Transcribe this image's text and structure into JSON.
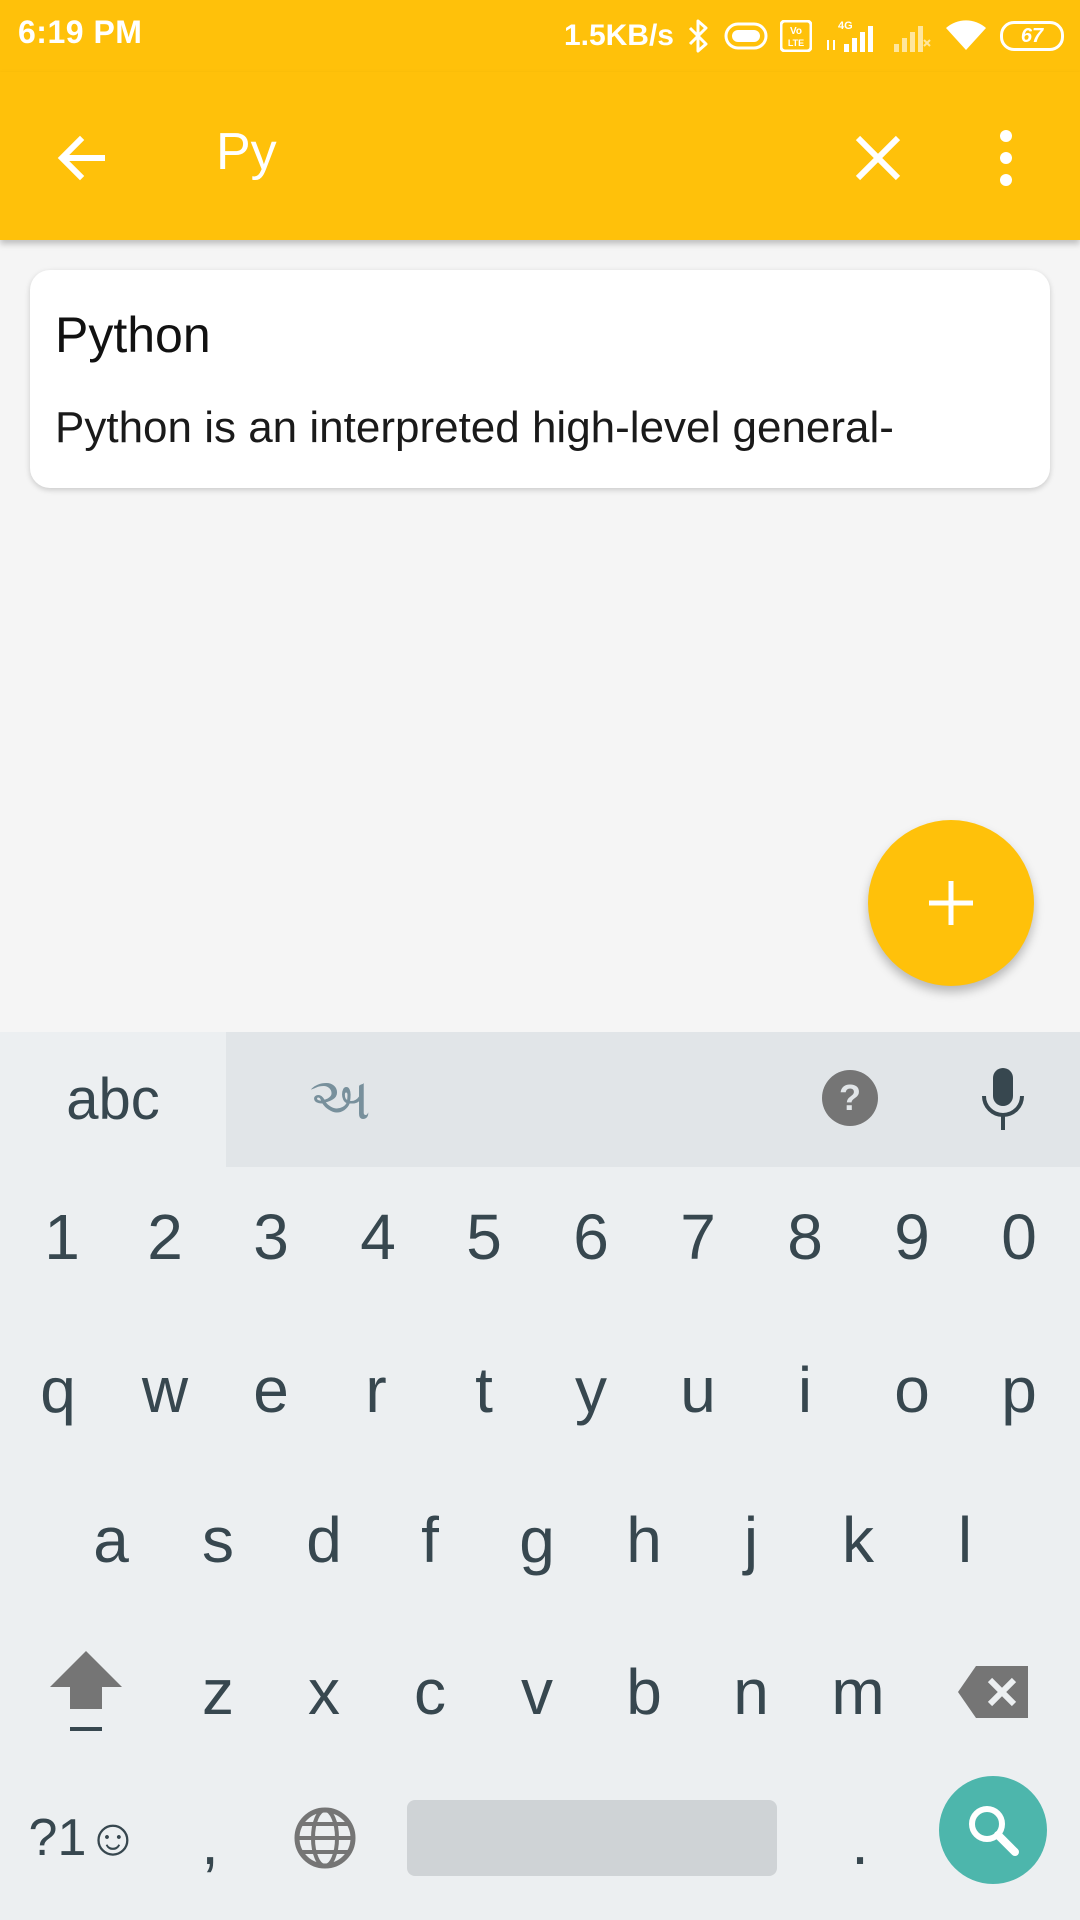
{
  "status_bar": {
    "time": "6:19 PM",
    "speed": "1.5KB/s",
    "battery": "67",
    "icons": [
      "bluetooth-icon",
      "data-saver-icon",
      "volte-icon",
      "4g-signal-icon",
      "signal-2-icon",
      "wifi-icon",
      "battery-icon"
    ]
  },
  "app_bar": {
    "search_query": "Py",
    "back_icon": "arrow-left-icon",
    "clear_icon": "close-icon",
    "more_icon": "more-vert-icon"
  },
  "results": [
    {
      "title": "Python",
      "snippet": "Python is an interpreted high-level general-"
    }
  ],
  "fab": {
    "icon": "plus-icon"
  },
  "keyboard": {
    "tabs": [
      "abc",
      "અ"
    ],
    "row_numbers": [
      "1",
      "2",
      "3",
      "4",
      "5",
      "6",
      "7",
      "8",
      "9",
      "0"
    ],
    "row1": [
      "q",
      "w",
      "e",
      "r",
      "t",
      "y",
      "u",
      "i",
      "o",
      "p"
    ],
    "row2": [
      "a",
      "s",
      "d",
      "f",
      "g",
      "h",
      "j",
      "k",
      "l"
    ],
    "row3": [
      "z",
      "x",
      "c",
      "v",
      "b",
      "n",
      "m"
    ],
    "bottom": {
      "symbols": "?1☺",
      "comma": ",",
      "period": "."
    },
    "colors": {
      "accent": "#FFC10A",
      "search": "#4DB6AC"
    }
  }
}
